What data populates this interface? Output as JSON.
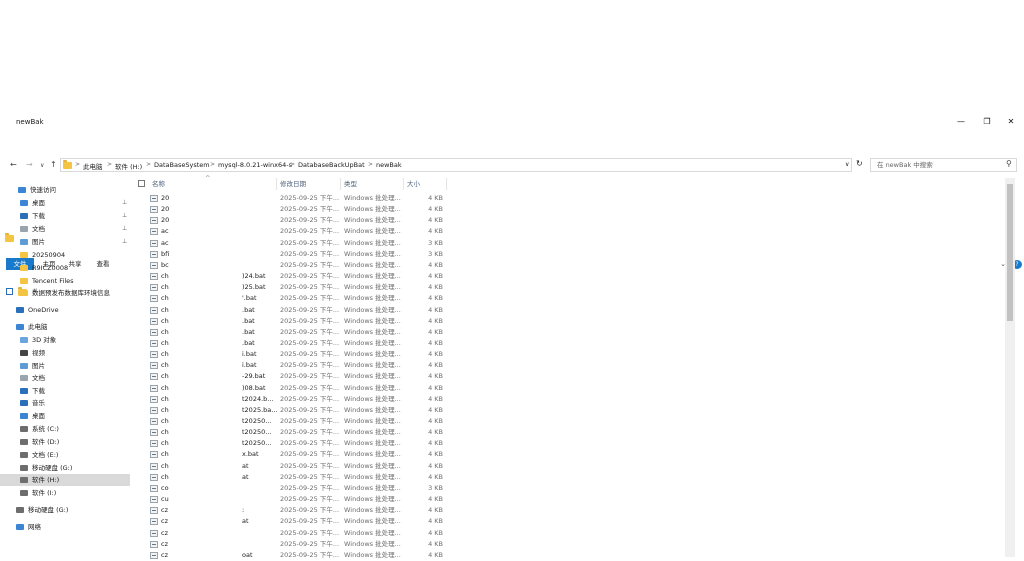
{
  "window": {
    "title": "newBak",
    "minimize_glyph": "—",
    "maximize_glyph": "❐",
    "close_glyph": "✕",
    "help_glyph": "?"
  },
  "ribbon": {
    "tabs": [
      "文件",
      "主页",
      "共享",
      "查看"
    ],
    "expand_glyph": "⌄"
  },
  "quick_access": {
    "dropdown_glyph": "∨"
  },
  "nav_buttons": {
    "back": "←",
    "forward": "→",
    "recent": "∨",
    "up": "↑",
    "refresh": "↻",
    "address_dropdown": "∨",
    "search": "⚲"
  },
  "address": {
    "crumbs": [
      "此电脑",
      "软件 (H:)",
      "DataBaseSystem",
      "mysql-8.0.21-winx64-s",
      "DatabaseBackUpBat",
      "newBak"
    ],
    "separator": ">"
  },
  "search": {
    "placeholder": "在 newBak 中搜索"
  },
  "nav_pane": {
    "items": [
      {
        "label": "快速访问",
        "icon": "star-icon",
        "pinned": false
      },
      {
        "label": "桌面",
        "icon": "desktop-icon",
        "pinned": true
      },
      {
        "label": "下载",
        "icon": "download-icon",
        "pinned": true
      },
      {
        "label": "文档",
        "icon": "document-icon",
        "pinned": true
      },
      {
        "label": "图片",
        "icon": "picture-icon",
        "pinned": true
      },
      {
        "label": "20250904",
        "icon": "folder-icon",
        "pinned": false
      },
      {
        "label": "R9ICZ0008",
        "icon": "folder-icon",
        "pinned": false
      },
      {
        "label": "Tencent Files",
        "icon": "folder-icon",
        "pinned": false
      },
      {
        "label": "数据预发布数据库环境信息",
        "icon": "folder-icon",
        "pinned": false
      },
      {
        "label": "OneDrive",
        "icon": "cloud-icon",
        "pinned": false
      },
      {
        "label": "此电脑",
        "icon": "computer-icon",
        "pinned": false
      },
      {
        "label": "3D 对象",
        "icon": "cube-icon",
        "pinned": false
      },
      {
        "label": "视频",
        "icon": "video-icon",
        "pinned": false
      },
      {
        "label": "图片",
        "icon": "picture-icon",
        "pinned": false
      },
      {
        "label": "文档",
        "icon": "document-icon",
        "pinned": false
      },
      {
        "label": "下载",
        "icon": "download-icon",
        "pinned": false
      },
      {
        "label": "音乐",
        "icon": "music-icon",
        "pinned": false
      },
      {
        "label": "桌面",
        "icon": "desktop-icon",
        "pinned": false
      },
      {
        "label": "系统 (C:)",
        "icon": "drive-icon",
        "pinned": false
      },
      {
        "label": "软件 (D:)",
        "icon": "drive-icon",
        "pinned": false
      },
      {
        "label": "文档 (E:)",
        "icon": "drive-icon",
        "pinned": false
      },
      {
        "label": "移动硬盘 (G:)",
        "icon": "drive-icon",
        "pinned": false
      },
      {
        "label": "软件 (H:)",
        "icon": "drive-icon",
        "pinned": false,
        "selected": true
      },
      {
        "label": "软件 (I:)",
        "icon": "drive-icon",
        "pinned": false
      },
      {
        "label": "移动硬盘 (G:)",
        "icon": "drive-icon",
        "pinned": false
      },
      {
        "label": "网络",
        "icon": "network-icon",
        "pinned": false
      }
    ],
    "pin_glyph": "📌"
  },
  "columns": {
    "name": "名称",
    "date": "修改日期",
    "type": "类型",
    "size": "大小",
    "sort_glyph": "^"
  },
  "files": [
    {
      "prefix": "20",
      "suffix": "",
      "date": "2025-09-25 下午...",
      "type": "Windows 批处理...",
      "size": "4 KB"
    },
    {
      "prefix": "20",
      "suffix": "",
      "date": "2025-09-25 下午...",
      "type": "Windows 批处理...",
      "size": "4 KB"
    },
    {
      "prefix": "20",
      "suffix": "",
      "date": "2025-09-25 下午...",
      "type": "Windows 批处理...",
      "size": "4 KB"
    },
    {
      "prefix": "ac",
      "suffix": "",
      "date": "2025-09-25 下午...",
      "type": "Windows 批处理...",
      "size": "4 KB"
    },
    {
      "prefix": "ac",
      "suffix": "",
      "date": "2025-09-25 下午...",
      "type": "Windows 批处理...",
      "size": "3 KB"
    },
    {
      "prefix": "bfi",
      "suffix": "",
      "date": "2025-09-25 下午...",
      "type": "Windows 批处理...",
      "size": "3 KB"
    },
    {
      "prefix": "bc",
      "suffix": "",
      "date": "2025-09-25 下午...",
      "type": "Windows 批处理...",
      "size": "4 KB"
    },
    {
      "prefix": "ch",
      "suffix": ")24.bat",
      "date": "2025-09-25 下午...",
      "type": "Windows 批处理...",
      "size": "4 KB"
    },
    {
      "prefix": "ch",
      "suffix": ")25.bat",
      "date": "2025-09-25 下午...",
      "type": "Windows 批处理...",
      "size": "4 KB"
    },
    {
      "prefix": "ch",
      "suffix": "'.bat",
      "date": "2025-09-25 下午...",
      "type": "Windows 批处理...",
      "size": "4 KB"
    },
    {
      "prefix": "ch",
      "suffix": ".bat",
      "date": "2025-09-25 下午...",
      "type": "Windows 批处理...",
      "size": "4 KB"
    },
    {
      "prefix": "ch",
      "suffix": ".bat",
      "date": "2025-09-25 下午...",
      "type": "Windows 批处理...",
      "size": "4 KB"
    },
    {
      "prefix": "ch",
      "suffix": ".bat",
      "date": "2025-09-25 下午...",
      "type": "Windows 批处理...",
      "size": "4 KB"
    },
    {
      "prefix": "ch",
      "suffix": ".bat",
      "date": "2025-09-25 下午...",
      "type": "Windows 批处理...",
      "size": "4 KB"
    },
    {
      "prefix": "ch",
      "suffix": "i.bat",
      "date": "2025-09-25 下午...",
      "type": "Windows 批处理...",
      "size": "4 KB"
    },
    {
      "prefix": "ch",
      "suffix": "i.bat",
      "date": "2025-09-25 下午...",
      "type": "Windows 批处理...",
      "size": "4 KB"
    },
    {
      "prefix": "ch",
      "suffix": "-29.bat",
      "date": "2025-09-25 下午...",
      "type": "Windows 批处理...",
      "size": "4 KB"
    },
    {
      "prefix": "ch",
      "suffix": ")08.bat",
      "date": "2025-09-25 下午...",
      "type": "Windows 批处理...",
      "size": "4 KB"
    },
    {
      "prefix": "ch",
      "suffix": "t2024.b...",
      "date": "2025-09-25 下午...",
      "type": "Windows 批处理...",
      "size": "4 KB"
    },
    {
      "prefix": "ch",
      "suffix": "t2025.ba...",
      "date": "2025-09-25 下午...",
      "type": "Windows 批处理...",
      "size": "4 KB"
    },
    {
      "prefix": "ch",
      "suffix": "t20250...",
      "date": "2025-09-25 下午...",
      "type": "Windows 批处理...",
      "size": "4 KB"
    },
    {
      "prefix": "ch",
      "suffix": "t20250...",
      "date": "2025-09-25 下午...",
      "type": "Windows 批处理...",
      "size": "4 KB"
    },
    {
      "prefix": "ch",
      "suffix": "t20250...",
      "date": "2025-09-25 下午...",
      "type": "Windows 批处理...",
      "size": "4 KB"
    },
    {
      "prefix": "ch",
      "suffix": "x.bat",
      "date": "2025-09-25 下午...",
      "type": "Windows 批处理...",
      "size": "4 KB"
    },
    {
      "prefix": "ch",
      "suffix": "at",
      "date": "2025-09-25 下午...",
      "type": "Windows 批处理...",
      "size": "4 KB"
    },
    {
      "prefix": "ch",
      "suffix": "at",
      "date": "2025-09-25 下午...",
      "type": "Windows 批处理...",
      "size": "4 KB"
    },
    {
      "prefix": "co",
      "suffix": "",
      "date": "2025-09-25 下午...",
      "type": "Windows 批处理...",
      "size": "3 KB"
    },
    {
      "prefix": "cu",
      "suffix": "",
      "date": "2025-09-25 下午...",
      "type": "Windows 批处理...",
      "size": "4 KB"
    },
    {
      "prefix": "cz",
      "suffix": ":",
      "date": "2025-09-25 下午...",
      "type": "Windows 批处理...",
      "size": "4 KB"
    },
    {
      "prefix": "cz",
      "suffix": "at",
      "date": "2025-09-25 下午...",
      "type": "Windows 批处理...",
      "size": "4 KB"
    },
    {
      "prefix": "cz",
      "suffix": "",
      "date": "2025-09-25 下午...",
      "type": "Windows 批处理...",
      "size": "4 KB"
    },
    {
      "prefix": "cz",
      "suffix": "",
      "date": "2025-09-25 下午...",
      "type": "Windows 批处理...",
      "size": "4 KB"
    },
    {
      "prefix": "cz",
      "suffix": "oat",
      "date": "2025-09-25 下午...",
      "type": "Windows 批处理...",
      "size": "4 KB"
    }
  ]
}
